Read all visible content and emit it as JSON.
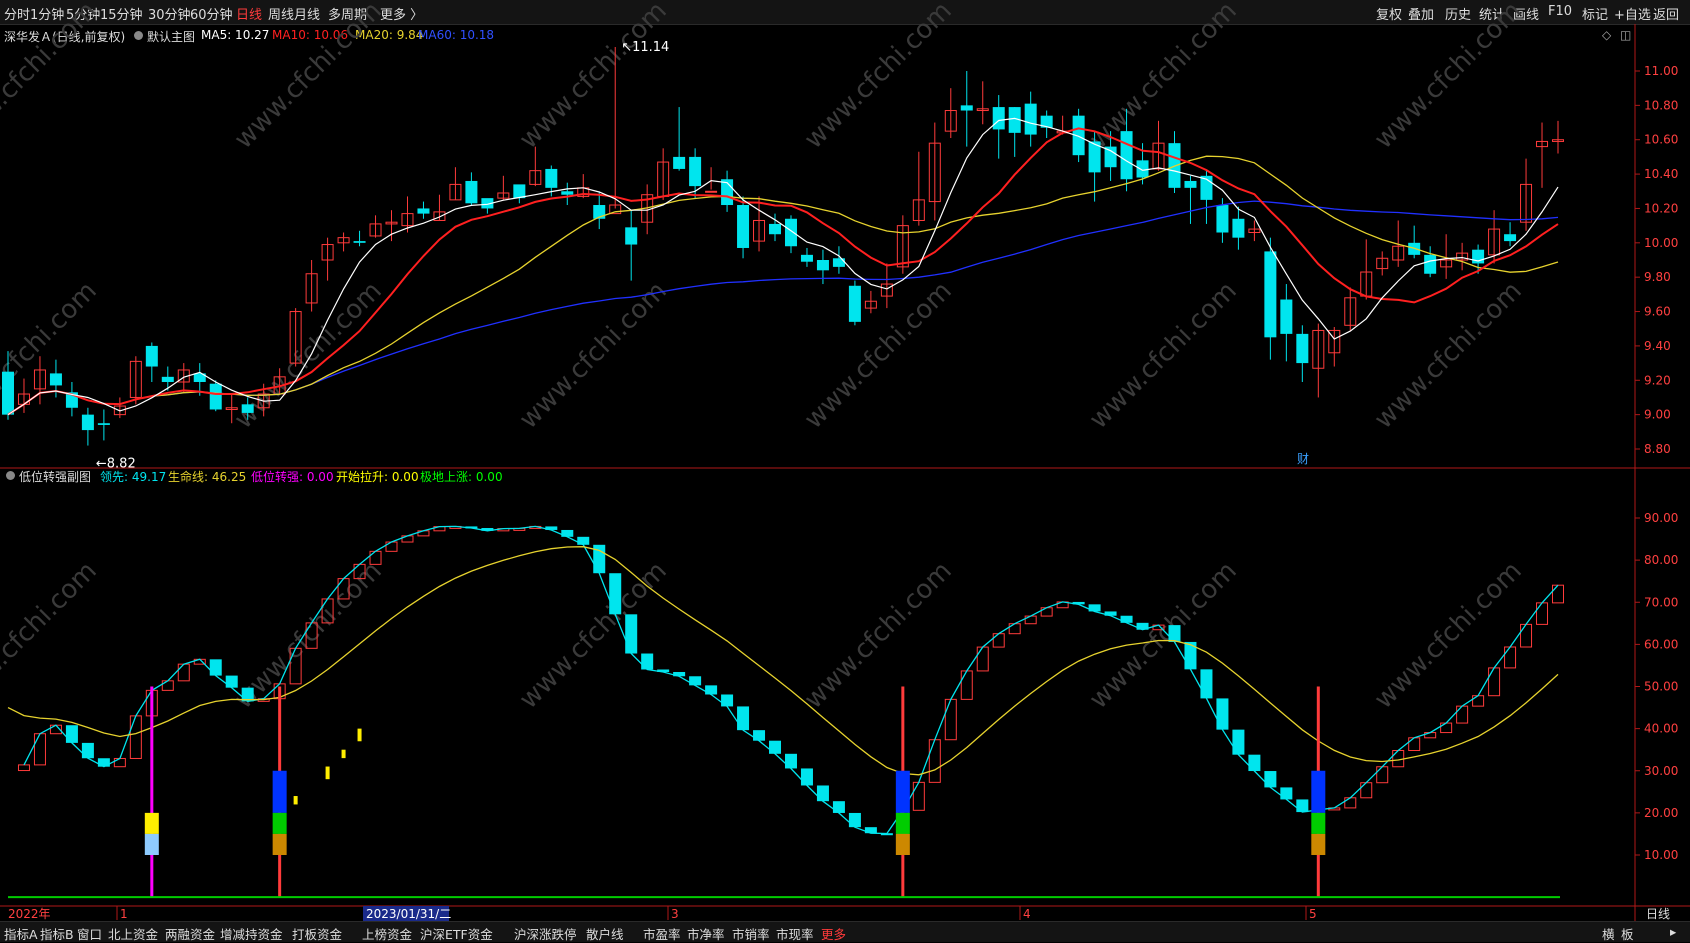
{
  "toolbar": {
    "periods": [
      "分时",
      "1分钟",
      "5分钟",
      "15分钟",
      "30分钟",
      "60分钟",
      "日线",
      "周线",
      "月线",
      "多周期",
      "更多 〉"
    ],
    "active_period": "日线",
    "right_buttons": [
      "复权",
      "叠加",
      "历史",
      "统计",
      "画线",
      "F10",
      "标记",
      "+自选",
      "返回"
    ]
  },
  "main_header": {
    "stock": "深华发Ａ(日线,前复权)",
    "template": "默认主图",
    "ma5": "MA5: 10.27",
    "ma10": "MA10: 10.06",
    "ma20": "MA20: 9.84",
    "ma60": "MA60: 10.18"
  },
  "sub_header": {
    "name": "低位转强副图",
    "lead": "领先: 49.17",
    "life": "生命线: 46.25",
    "low_strong": "低位转强: 0.00",
    "start_up": "开始拉升: 0.00",
    "bottom_up": "极地上涨: 0.00"
  },
  "price_axis": [
    "11.00",
    "10.80",
    "10.60",
    "10.40",
    "10.20",
    "10.00",
    "9.80",
    "9.60",
    "9.40",
    "9.20",
    "9.00",
    "8.80"
  ],
  "sub_axis": [
    "90.00",
    "80.00",
    "70.00",
    "60.00",
    "50.00",
    "40.00",
    "30.00",
    "20.00",
    "10.00"
  ],
  "annotations": {
    "high": "11.14",
    "low": "8.82",
    "finance_mark": "财"
  },
  "date_axis": {
    "year": "2022年",
    "cursor_date": "2023/01/31/二",
    "months": [
      "1",
      "3",
      "4",
      "5"
    ]
  },
  "period_label": "日线",
  "watermark": "www.cfchi.com",
  "bottom_tabs": [
    "指标A",
    "指标B",
    "窗口",
    "北上资金",
    "两融资金",
    "增减持资金",
    "打板资金",
    "上榜资金",
    "沪深ETF资金",
    "沪深涨跌停",
    "散户线",
    "市盈率",
    "市净率",
    "市销率",
    "市现率",
    "更多"
  ],
  "bottom_right": [
    "横",
    "板",
    "▸"
  ],
  "colors": {
    "up": "#ff3b3b",
    "down": "#00e5ee",
    "ma5": "#ffffff",
    "ma10": "#ff2020",
    "ma20": "#e6d22e",
    "ma60": "#2030ff",
    "sub_fast": "#00e5ee",
    "sub_slow": "#e6d22e",
    "zero_line": "#00cc00",
    "magenta": "#ff00ff",
    "blue": "#0033ff",
    "green": "#00cc00",
    "orange": "#cc8800"
  },
  "chart_data": {
    "type": "candlestick",
    "candles": [
      [
        9.25,
        9.0,
        9.37,
        8.97
      ],
      [
        9.06,
        9.12,
        9.21,
        9.01
      ],
      [
        9.15,
        9.26,
        9.34,
        9.06
      ],
      [
        9.24,
        9.17,
        9.32,
        9.1
      ],
      [
        9.13,
        9.04,
        9.19,
        8.99
      ],
      [
        9.0,
        8.91,
        9.04,
        8.82
      ],
      [
        8.95,
        8.94,
        9.03,
        8.85
      ],
      [
        9.0,
        9.05,
        9.1,
        8.98
      ],
      [
        9.1,
        9.31,
        9.34,
        9.06
      ],
      [
        9.4,
        9.28,
        9.42,
        9.19
      ],
      [
        9.22,
        9.19,
        9.28,
        9.14
      ],
      [
        9.19,
        9.26,
        9.3,
        9.13
      ],
      [
        9.24,
        9.19,
        9.3,
        9.11
      ],
      [
        9.18,
        9.03,
        9.2,
        9.02
      ],
      [
        9.03,
        9.04,
        9.12,
        8.95
      ],
      [
        9.06,
        9.01,
        9.1,
        8.97
      ],
      [
        9.04,
        9.12,
        9.18,
        8.99
      ],
      [
        9.12,
        9.22,
        9.27,
        9.12
      ],
      [
        9.3,
        9.6,
        9.62,
        9.28
      ],
      [
        9.65,
        9.82,
        9.9,
        9.6
      ],
      [
        9.9,
        9.99,
        10.03,
        9.78
      ],
      [
        10.0,
        10.03,
        10.06,
        9.95
      ],
      [
        10.01,
        10.0,
        10.07,
        9.98
      ],
      [
        10.04,
        10.11,
        10.16,
        10.03
      ],
      [
        10.11,
        10.12,
        10.19,
        10.01
      ],
      [
        10.1,
        10.17,
        10.27,
        10.06
      ],
      [
        10.2,
        10.17,
        10.24,
        10.14
      ],
      [
        10.13,
        10.18,
        10.28,
        10.13
      ],
      [
        10.25,
        10.34,
        10.44,
        10.25
      ],
      [
        10.36,
        10.23,
        10.41,
        10.22
      ],
      [
        10.26,
        10.2,
        10.24,
        10.17
      ],
      [
        10.26,
        10.29,
        10.39,
        10.25
      ],
      [
        10.34,
        10.26,
        10.32,
        10.23
      ],
      [
        10.34,
        10.42,
        10.56,
        10.33
      ],
      [
        10.43,
        10.32,
        10.45,
        10.27
      ],
      [
        10.3,
        10.28,
        10.35,
        10.22
      ],
      [
        10.27,
        10.32,
        10.4,
        10.26
      ],
      [
        10.22,
        10.14,
        10.3,
        10.08
      ],
      [
        10.17,
        10.22,
        11.14,
        10.2
      ],
      [
        10.09,
        9.99,
        10.19,
        9.78
      ],
      [
        10.12,
        10.28,
        10.34,
        10.05
      ],
      [
        10.27,
        10.47,
        10.55,
        10.25
      ],
      [
        10.5,
        10.43,
        10.79,
        10.42
      ],
      [
        10.5,
        10.33,
        10.55,
        10.26
      ],
      [
        10.3,
        10.3,
        10.44,
        10.31
      ],
      [
        10.37,
        10.22,
        10.42,
        10.18
      ],
      [
        10.22,
        9.97,
        10.27,
        9.91
      ],
      [
        10.01,
        10.13,
        10.27,
        9.95
      ],
      [
        10.11,
        10.05,
        10.17,
        10.01
      ],
      [
        10.14,
        9.98,
        10.16,
        9.94
      ],
      [
        9.93,
        9.89,
        9.97,
        9.86
      ],
      [
        9.9,
        9.84,
        9.96,
        9.76
      ],
      [
        9.91,
        9.86,
        9.98,
        9.82
      ],
      [
        9.75,
        9.54,
        9.78,
        9.52
      ],
      [
        9.62,
        9.66,
        9.72,
        9.59
      ],
      [
        9.69,
        9.76,
        9.88,
        9.62
      ],
      [
        9.86,
        10.1,
        10.16,
        9.82
      ],
      [
        10.13,
        10.25,
        10.53,
        10.1
      ],
      [
        10.24,
        10.58,
        10.7,
        10.13
      ],
      [
        10.65,
        10.77,
        10.9,
        10.61
      ],
      [
        10.8,
        10.77,
        11.0,
        10.56
      ],
      [
        10.77,
        10.78,
        10.94,
        10.69
      ],
      [
        10.79,
        10.66,
        10.86,
        10.49
      ],
      [
        10.79,
        10.64,
        10.79,
        10.5
      ],
      [
        10.81,
        10.63,
        10.88,
        10.56
      ],
      [
        10.74,
        10.67,
        10.77,
        10.61
      ],
      [
        10.64,
        10.65,
        10.74,
        10.63
      ],
      [
        10.74,
        10.51,
        10.78,
        10.47
      ],
      [
        10.59,
        10.41,
        10.65,
        10.24
      ],
      [
        10.56,
        10.44,
        10.65,
        10.36
      ],
      [
        10.65,
        10.37,
        10.78,
        10.3
      ],
      [
        10.48,
        10.38,
        10.58,
        10.34
      ],
      [
        10.43,
        10.58,
        10.71,
        10.42
      ],
      [
        10.58,
        10.32,
        10.65,
        10.29
      ],
      [
        10.36,
        10.32,
        10.39,
        10.11
      ],
      [
        10.39,
        10.25,
        10.42,
        10.11
      ],
      [
        10.22,
        10.06,
        10.26,
        10.0
      ],
      [
        10.14,
        10.03,
        10.21,
        9.96
      ],
      [
        10.06,
        10.08,
        10.13,
        10.01
      ],
      [
        9.95,
        9.45,
        10.03,
        9.32
      ],
      [
        9.67,
        9.47,
        9.76,
        9.31
      ],
      [
        9.47,
        9.3,
        9.52,
        9.19
      ],
      [
        9.27,
        9.49,
        9.53,
        9.1
      ],
      [
        9.36,
        9.49,
        9.51,
        9.28
      ],
      [
        9.52,
        9.68,
        9.74,
        9.49
      ],
      [
        9.69,
        9.83,
        10.02,
        9.67
      ],
      [
        9.85,
        9.91,
        9.95,
        9.81
      ],
      [
        9.9,
        9.98,
        10.13,
        9.86
      ],
      [
        10.0,
        9.93,
        10.1,
        9.91
      ],
      [
        9.93,
        9.82,
        9.98,
        9.8
      ],
      [
        9.86,
        9.9,
        10.05,
        9.79
      ],
      [
        9.9,
        9.94,
        10.0,
        9.84
      ],
      [
        9.96,
        9.88,
        9.99,
        9.82
      ],
      [
        9.93,
        10.08,
        10.19,
        9.88
      ],
      [
        10.05,
        10.01,
        10.12,
        9.98
      ],
      [
        10.12,
        10.34,
        10.49,
        10.07
      ],
      [
        10.56,
        10.59,
        10.7,
        10.32
      ],
      [
        10.59,
        10.6,
        10.71,
        10.52
      ]
    ]
  }
}
